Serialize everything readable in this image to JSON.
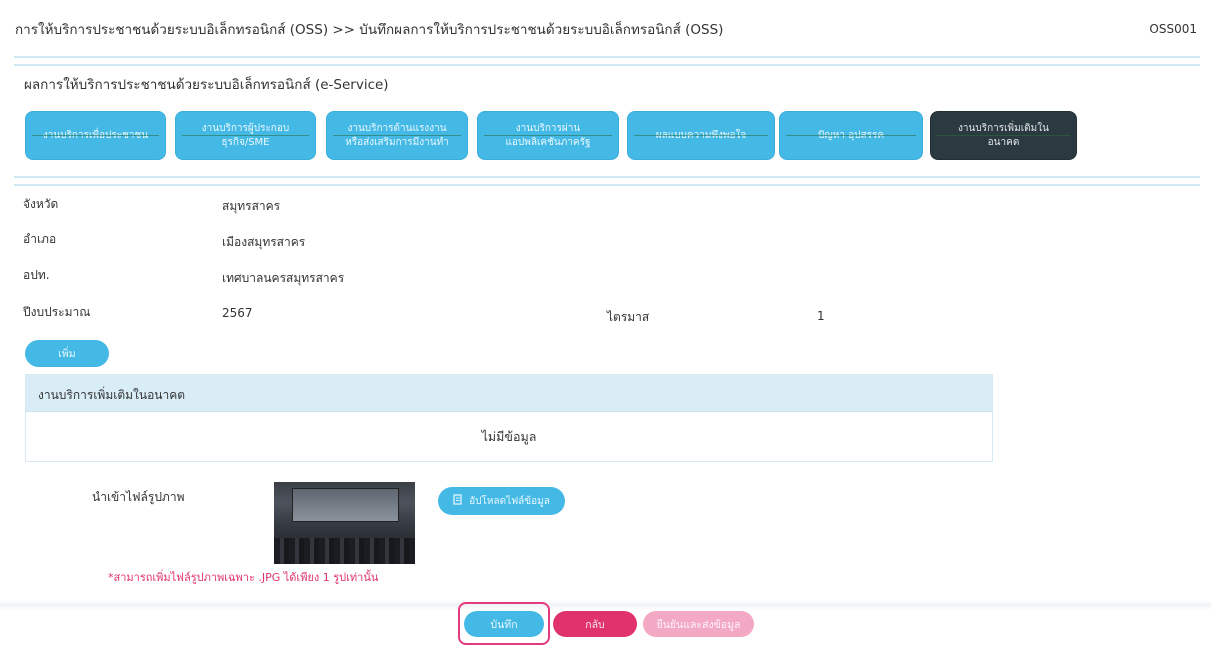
{
  "header": {
    "breadcrumb": "การให้บริการประชาชนด้วยระบบอิเล็กทรอนิกส์ (OSS) >> บันทึกผลการให้บริการประชาชนด้วยระบบอิเล็กทรอนิกส์ (OSS)",
    "screen_code": "OSS001"
  },
  "panel": {
    "title": "ผลการให้บริการประชาชนด้วยระบบอิเล็กทรอนิกส์ (e-Service)",
    "tabs": [
      {
        "line1": "งานบริการเพื่อประชาชน",
        "line2": "",
        "active": false
      },
      {
        "line1": "งานบริการผู้ประกอบ",
        "line2": "ธุรกิจ/SME",
        "active": false
      },
      {
        "line1": "งานบริการด้านแรงงาน",
        "line2": "หรือส่งเสริมการมีงานทำ",
        "active": false
      },
      {
        "line1": "งานบริการผ่าน",
        "line2": "แอปพลิเคชันภาครัฐ",
        "active": false
      },
      {
        "line1": "ผลแบบความพึงพอใจ",
        "line2": "",
        "active": false
      },
      {
        "line1": "ปัญหา อุปสรรค",
        "line2": "",
        "active": false
      },
      {
        "line1": "งานบริการเพิ่มเติมใน",
        "line2": "อนาคต",
        "active": true
      }
    ]
  },
  "info": {
    "province_label": "จังหวัด",
    "province_value": "สมุทรสาคร",
    "district_label": "อำเภอ",
    "district_value": "เมืองสมุทรสาคร",
    "lao_label": "อปท.",
    "lao_value": "เทศบาลนครสมุทรสาคร",
    "year_label": "ปีงบประมาณ",
    "year_value": "2567",
    "quarter_label": "ไตรมาส",
    "quarter_value": "1"
  },
  "add_button": "เพิ่ม",
  "table": {
    "header": "งานบริการเพิ่มเติมในอนาคต",
    "empty_text": "ไม่มีข้อมูล"
  },
  "upload": {
    "label": "นำเข้าไฟล์รูปภาพ",
    "button": "อัปโหลดไฟล์ข้อมูล",
    "note": "*สามารถเพิ่มไฟล์รูปภาพเฉพาะ .JPG ได้เพียง 1 รูปเท่านั้น"
  },
  "actions": {
    "save": "บันทึก",
    "back": "กลับ",
    "confirm": "ยืนยันและส่งข้อมูล"
  },
  "colors": {
    "primary": "#45b9e6",
    "active_tab": "#2b3a41",
    "danger": "#e0336e",
    "danger_light": "#f3a8c4",
    "divider": "#cfe8f3"
  }
}
